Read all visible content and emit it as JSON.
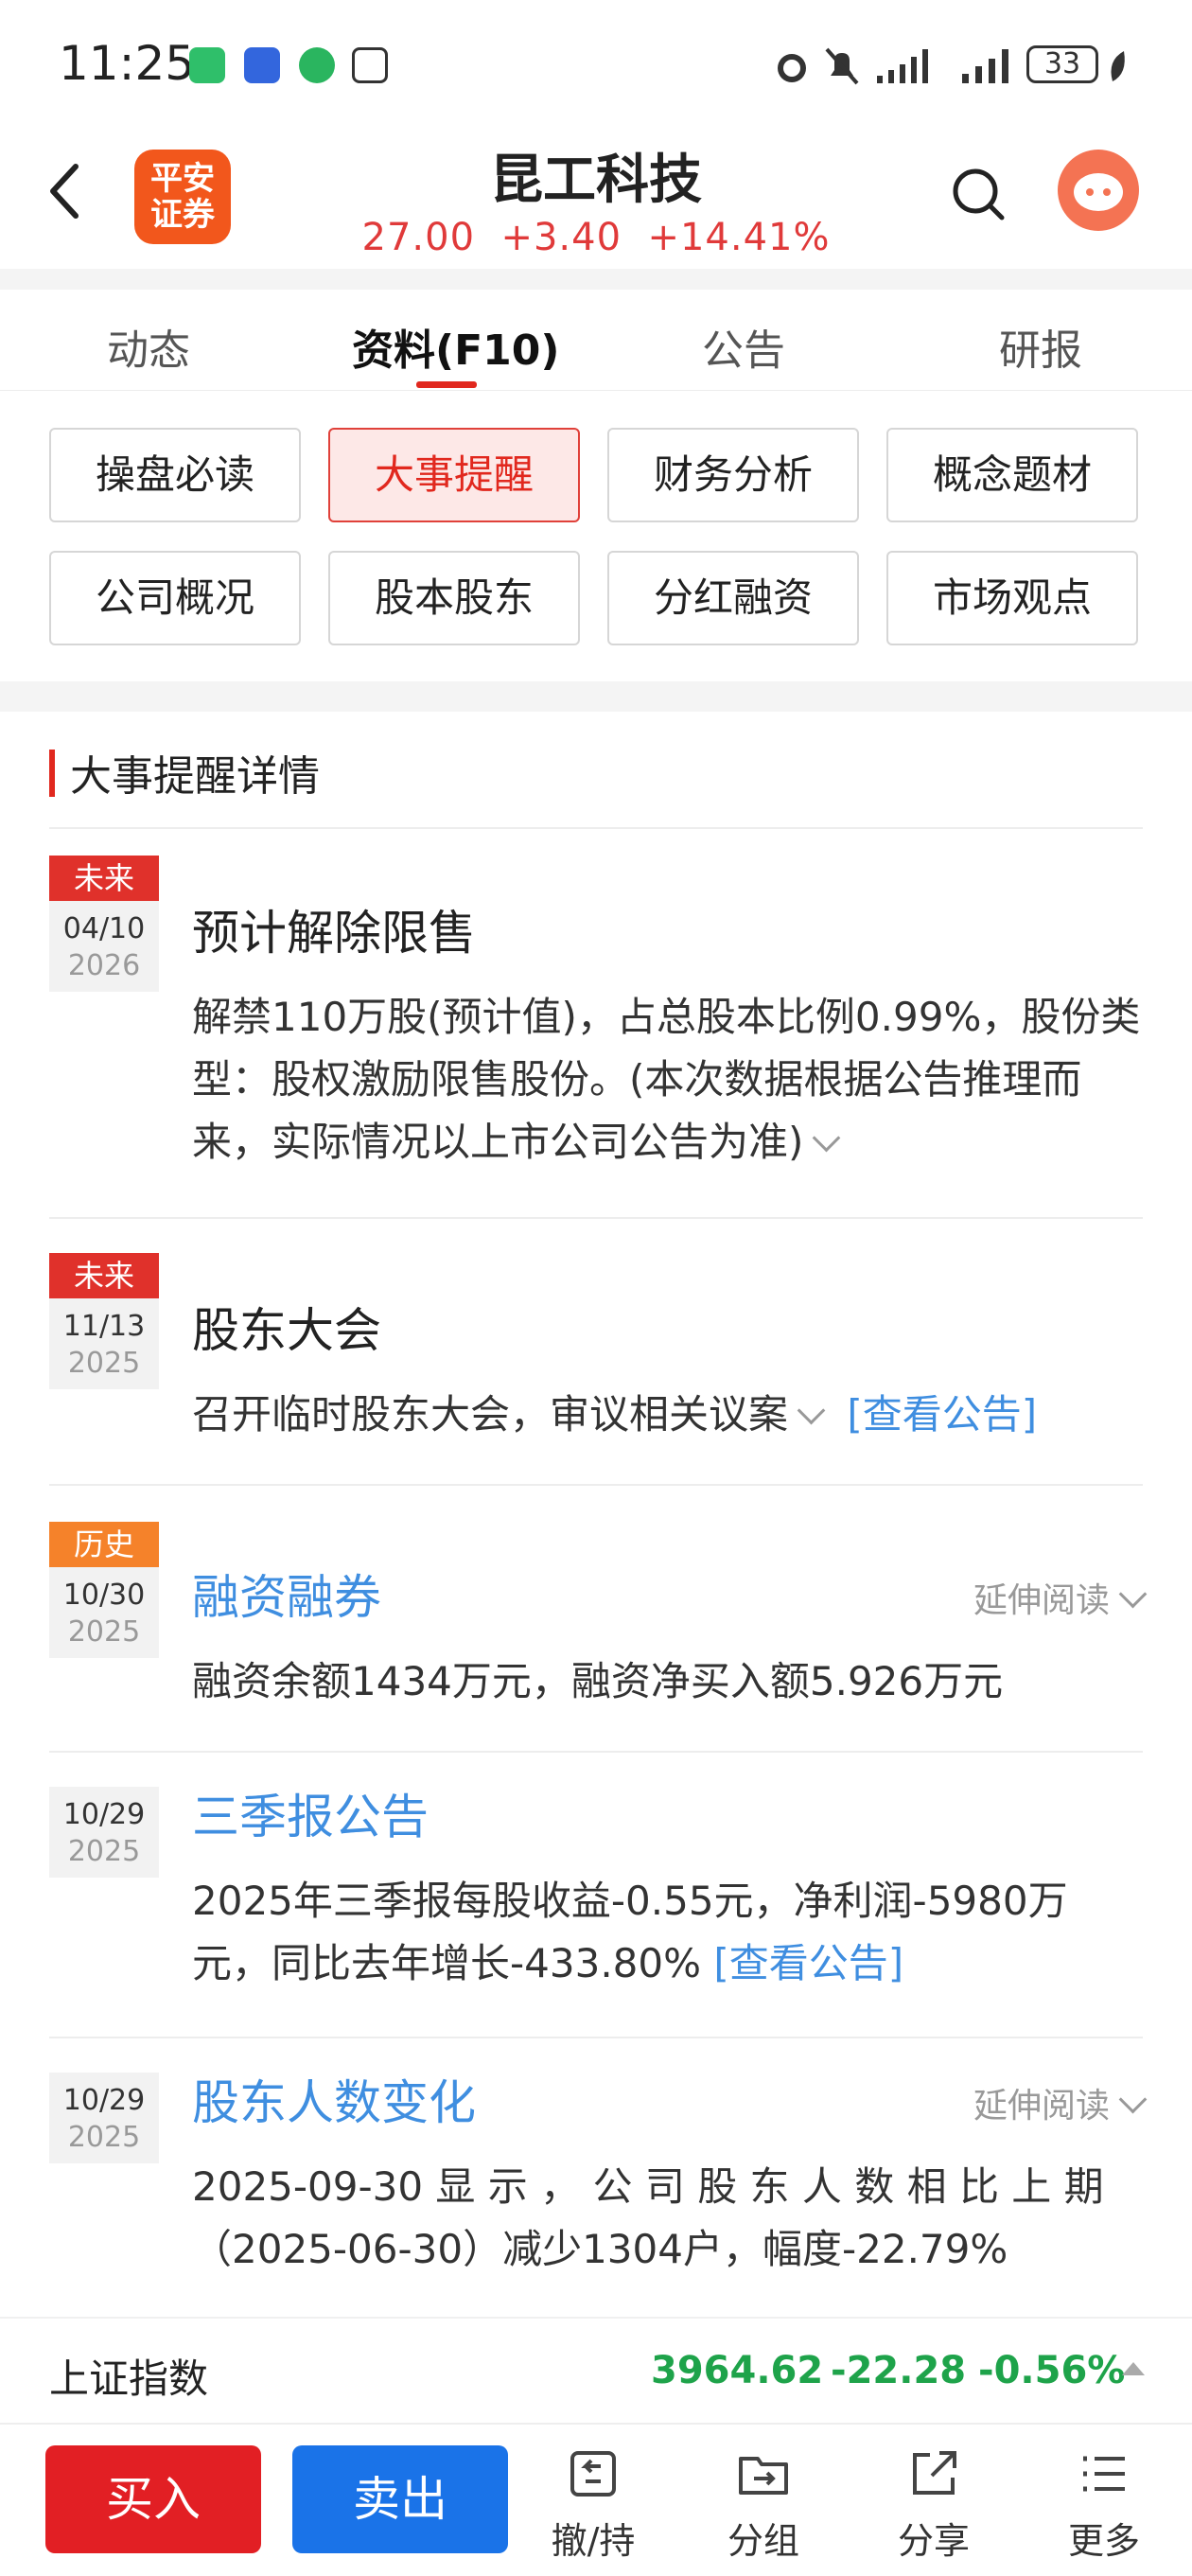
{
  "status": {
    "time": "11:25",
    "battery": "33"
  },
  "header": {
    "logo_text_line1": "平安",
    "logo_text_line2": "证券",
    "stock_name": "昆工科技",
    "quote": "27.00  +3.40  +14.41%"
  },
  "tabs": [
    {
      "label": "动态"
    },
    {
      "label": "资料(F10)",
      "active": true
    },
    {
      "label": "公告"
    },
    {
      "label": "研报"
    }
  ],
  "grid": [
    {
      "label": "操盘必读"
    },
    {
      "label": "大事提醒",
      "active": true
    },
    {
      "label": "财务分析"
    },
    {
      "label": "概念题材"
    },
    {
      "label": "公司概况"
    },
    {
      "label": "股本股东"
    },
    {
      "label": "分红融资"
    },
    {
      "label": "市场观点"
    }
  ],
  "section": {
    "title": "大事提醒详情"
  },
  "events": [
    {
      "badge": "未来",
      "badge_color": "#e0312b",
      "date": "04/10",
      "year": "2026",
      "title": "预计解除限售",
      "desc": "解禁110万股(预计值)，占总股本比例0.99%，股份类型：股权激励限售股份。(本次数据根据公告推理而来，实际情况以上市公司公告为准)"
    },
    {
      "badge": "未来",
      "badge_color": "#e0312b",
      "date": "11/13",
      "year": "2025",
      "title": "股东大会",
      "desc": "召开临时股东大会，审议相关议案",
      "link": "[查看公告]"
    },
    {
      "badge": "历史",
      "badge_color": "#f5822a",
      "date": "10/30",
      "year": "2025",
      "title": "融资融券",
      "more": "延伸阅读",
      "desc": "融资余额1434万元，融资净买入额5.926万元"
    },
    {
      "date": "10/29",
      "year": "2025",
      "title": "三季报公告",
      "desc": "2025年三季报每股收益-0.55元，净利润-5980万元，同比去年增长-433.80%",
      "link": "[查看公告]"
    },
    {
      "date": "10/29",
      "year": "2025",
      "title": "股东人数变化",
      "more": "延伸阅读",
      "desc_line1": "2025-09-30 显 示 ， 公 司 股 东 人 数 相 比 上 期",
      "desc_line2": "（2025-06-30）减少1304户，幅度-22.79%"
    }
  ],
  "index": {
    "name": "上证指数",
    "value": "3964.62",
    "change": "-22.28",
    "percent": "-0.56%"
  },
  "bottom": {
    "buy": "买入",
    "sell": "卖出",
    "tools": [
      {
        "label": "撤/持",
        "icon": "withdraw-icon"
      },
      {
        "label": "分组",
        "icon": "folder-icon"
      },
      {
        "label": "分享",
        "icon": "share-icon"
      },
      {
        "label": "更多",
        "icon": "menu-icon"
      }
    ]
  },
  "colors": {
    "accent_red": "#e1281e",
    "link_blue": "#3f8ee0",
    "down_green": "#1ea34a",
    "sell_blue": "#1a73e8"
  }
}
